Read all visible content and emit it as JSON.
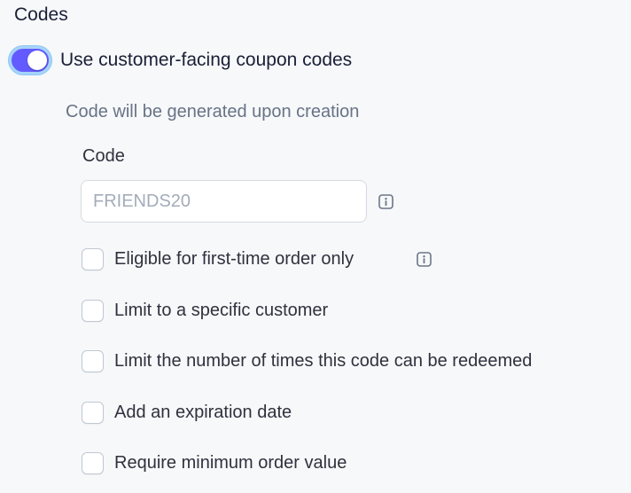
{
  "section": {
    "title": "Codes"
  },
  "toggle": {
    "label": "Use customer-facing coupon codes",
    "on": true,
    "accent": "#635bff"
  },
  "helper_text": "Code will be generated upon creation",
  "code_field": {
    "label": "Code",
    "value": "",
    "placeholder": "FRIENDS20",
    "info_icon": "info-icon"
  },
  "options": [
    {
      "label": "Eligible for first-time order only",
      "checked": false,
      "info_icon": "info-icon"
    },
    {
      "label": "Limit to a specific customer",
      "checked": false
    },
    {
      "label": "Limit the number of times this code can be redeemed",
      "checked": false
    },
    {
      "label": "Add an expiration date",
      "checked": false
    },
    {
      "label": "Require minimum order value",
      "checked": false
    }
  ]
}
